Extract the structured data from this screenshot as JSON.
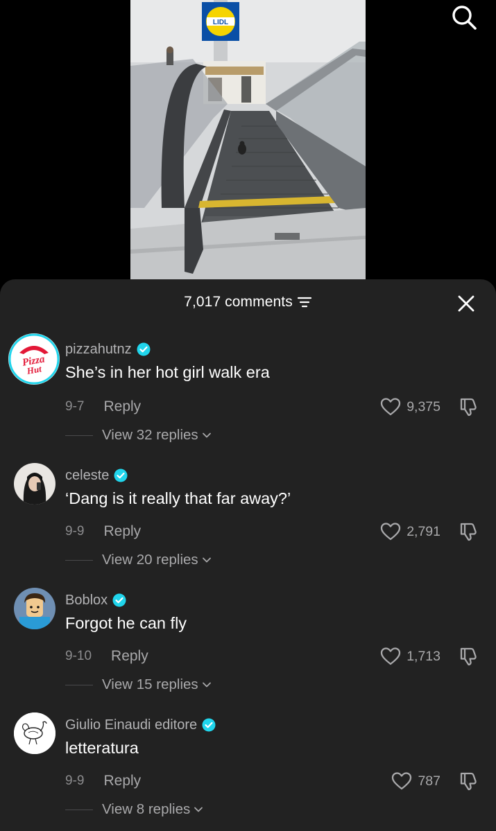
{
  "video": {
    "store_sign": "LIDL"
  },
  "comments_header": {
    "count_label": "7,017 comments"
  },
  "comments": [
    {
      "username": "pizzahutnz",
      "verified": true,
      "text": "She’s in her hot girl walk era",
      "date": "9-7",
      "reply_label": "Reply",
      "likes": "9,375",
      "view_replies": "View 32 replies",
      "avatar_logo_text": "Pizza Hut"
    },
    {
      "username": "celeste",
      "verified": true,
      "text": "‘Dang is it really that far away?’",
      "date": "9-9",
      "reply_label": "Reply",
      "likes": "2,791",
      "view_replies": "View 20 replies"
    },
    {
      "username": "Boblox",
      "verified": true,
      "text": "Forgot he can fly",
      "date": "9-10",
      "reply_label": "Reply",
      "likes": "1,713",
      "view_replies": "View 15 replies"
    },
    {
      "username": "Giulio Einaudi editore",
      "verified": true,
      "text": "letteratura",
      "date": "9-9",
      "reply_label": "Reply",
      "likes": "787",
      "view_replies": "View 8 replies"
    }
  ],
  "colors": {
    "sheet_bg": "#222222",
    "verified": "#20d5ec",
    "secondary_text": "#a9a9ab",
    "pizza_hut_red": "#e31837"
  },
  "icons": [
    "search-icon",
    "close-icon",
    "filter-icon",
    "verified-badge-icon",
    "heart-icon",
    "dislike-icon",
    "chevron-down-icon"
  ]
}
